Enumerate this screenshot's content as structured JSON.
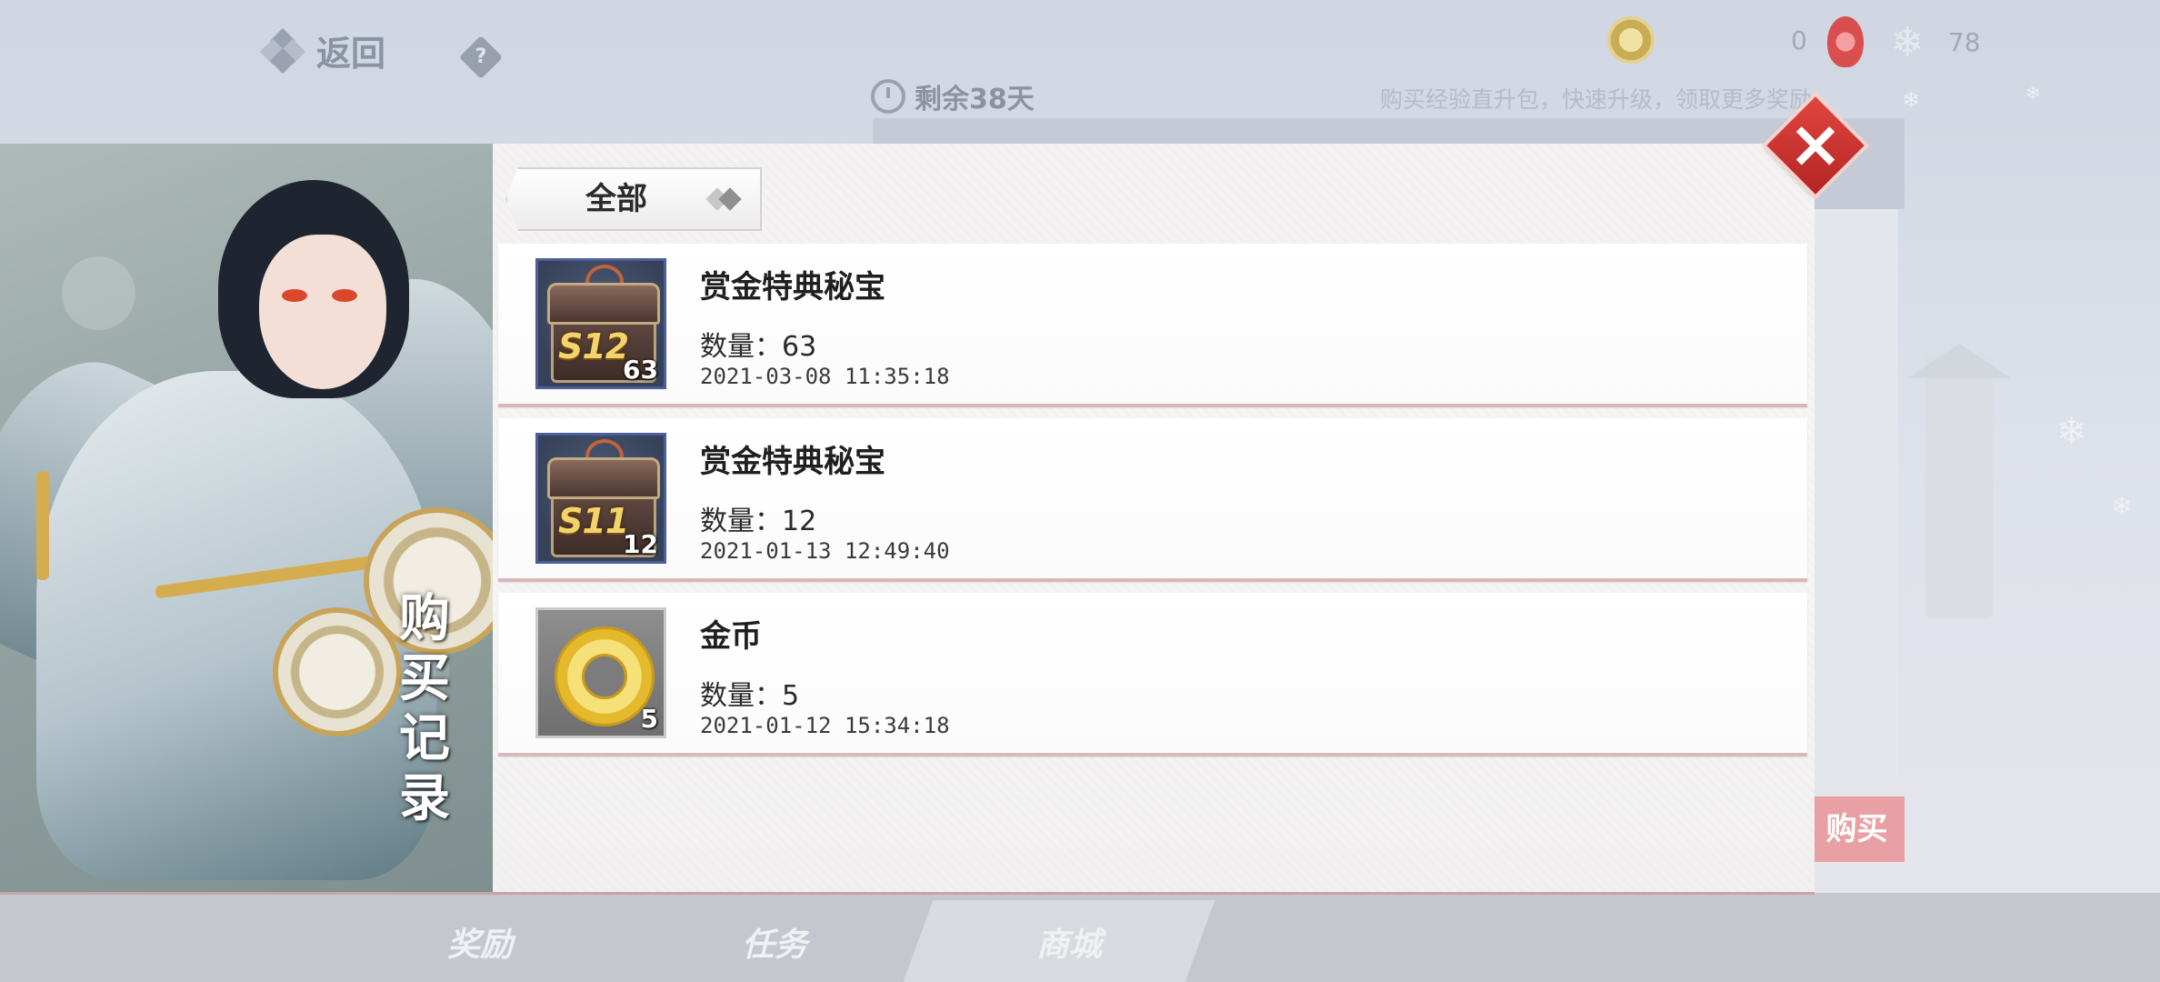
{
  "background": {
    "back_label": "返回",
    "help_label": "?",
    "currency_1_value": "0",
    "currency_2_value": "78",
    "timer_label": "剩余38天",
    "hint_text": "购买经验直升包，快速升级，领取更多奖励",
    "buy_button_label": "购买",
    "bottom_tabs": [
      {
        "label": "奖励"
      },
      {
        "label": "任务"
      },
      {
        "label": "商城"
      }
    ]
  },
  "modal": {
    "side_title": "购买记录",
    "filter": {
      "selected": "全部"
    },
    "records": [
      {
        "name": "赏金特典秘宝",
        "quantity_text": "数量：63",
        "quantity": 63,
        "time": "2021-03-08 11:35:18",
        "icon": "chest-s12-icon",
        "icon_tag": "S12"
      },
      {
        "name": "赏金特典秘宝",
        "quantity_text": "数量：12",
        "quantity": 12,
        "time": "2021-01-13 12:49:40",
        "icon": "chest-s11-icon",
        "icon_tag": "S11"
      },
      {
        "name": "金币",
        "quantity_text": "数量：5",
        "quantity": 5,
        "time": "2021-01-12 15:34:18",
        "icon": "gold-coin-icon"
      }
    ]
  },
  "colors": {
    "accent_red": "#c8302c",
    "row_border": "#d9b7bb",
    "frame_blue": "#4a5f9c"
  }
}
